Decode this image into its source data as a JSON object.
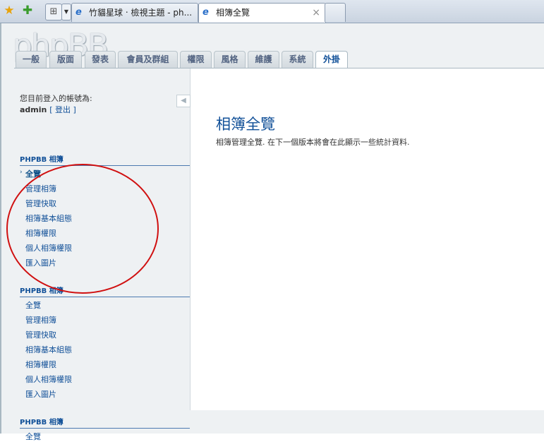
{
  "browser": {
    "tabs": [
      {
        "label": "竹貓星球 ‧ 檢視主題 - ph..."
      },
      {
        "label": "相簿全覽"
      }
    ],
    "close_glyph": "×"
  },
  "logo": "phpBB",
  "nav": {
    "tabs": [
      "一般",
      "版面",
      "發表",
      "會員及群組",
      "權限",
      "風格",
      "維護",
      "系統",
      "外掛"
    ],
    "active_index": 8
  },
  "sidebar": {
    "logged_in_label": "您目前登入的帳號為:",
    "username": "admin",
    "logout_label": "[ 登出 ]",
    "sections": [
      {
        "title": "PHPBB 相簿",
        "items": [
          "全覽",
          "管理相簿",
          "管理快取",
          "相簿基本組態",
          "相簿權限",
          "個人相簿權限",
          "匯入圖片"
        ]
      },
      {
        "title": "PHPBB 相簿",
        "items": [
          "全覽",
          "管理相簿",
          "管理快取",
          "相簿基本組態",
          "相簿權限",
          "個人相簿權限",
          "匯入圖片"
        ]
      },
      {
        "title": "PHPBB 相簿",
        "items": [
          "全覽"
        ]
      }
    ]
  },
  "main": {
    "title": "相簿全覽",
    "description": "相簿管理全覽. 在下一個版本將會在此顯示一些統計資料."
  },
  "colors": {
    "link": "#115098",
    "annotation": "#d01010"
  }
}
